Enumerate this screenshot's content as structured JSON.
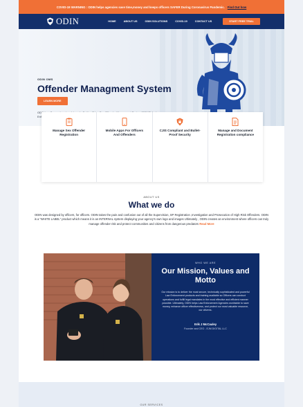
{
  "warning": {
    "text": "COVID-19 WARNING : ODIN helps agencies save time,money and keeps officers SAFER During Coronavirus Pandemic.",
    "link": "Find Out how"
  },
  "nav": {
    "logo": "ODIN",
    "items": [
      "HOME",
      "ABOUT US",
      "ODIN SOLUTIONS",
      "COVID-19",
      "CONTACT US"
    ],
    "cta": "START FREE TRIAL"
  },
  "hero": {
    "tag": "ODIN OMS",
    "title": "Offender Managment System",
    "description": "ODIN is a Comprehensive, Internal , Cutting-Edge Sex Offender Managment System(SOMS) for Law Enforcement Use Only",
    "button": "LEARN MORE"
  },
  "features": [
    {
      "label": "Manage Sex Offender Registration",
      "icon": "clipboard-icon"
    },
    {
      "label": "Mobile Apps For Officers And Offenders",
      "icon": "mobile-icon"
    },
    {
      "label": "CJIS Compliant and Bullet-Proof Security",
      "icon": "lock-shield-icon"
    },
    {
      "label": "Manage and Document Registration compliance",
      "icon": "document-icon"
    }
  ],
  "about": {
    "tag": "ABOUT US",
    "title": "What we do",
    "text": "ODIN was designed by officers, for officers. ODIN takes the pain and confusion out of all the Supervision, SP Registration ,Investigation and Prosecution of High Risk Offenders. ODIN is a \"WHITE LABEL\" product which means it is an INTERNAL system displaying your agency's own logo and images Ultimately , ODIN creates an environment where officers can truly manage offender risk and protect communities and citizens from dangerous predators",
    "more": "Read More"
  },
  "mission": {
    "tag": "WHO WE ARE",
    "title": "Our Mission, Values and Motto",
    "text": "Our mission is to deliver the most secure, technically sophisticated and powerful Law Enforcement products and training available so Officers can conduct operations and fulfill legal mandates in the most effective and efficient manner possible. Ultimately, ODIN helps Law Enforcement Agencies worldwide to save money, enhance officer effectiveness, and protect our most valuable resource, our citizens.",
    "name": "Erik J McCauley",
    "role": "Founder and CEO - EJM DIGITAL LLC"
  },
  "footer": {
    "tag": "OUR SERVICES"
  },
  "colors": {
    "orange": "#f07036",
    "navy": "#132f6b",
    "panel": "#0e2b68"
  }
}
